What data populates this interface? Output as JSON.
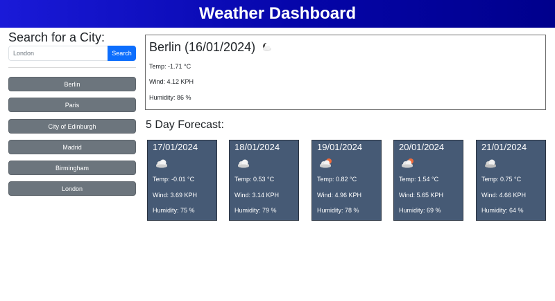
{
  "header": {
    "title": "Weather Dashboard"
  },
  "search": {
    "title": "Search for a City:",
    "input_value": "London",
    "button_label": "Search"
  },
  "history": [
    "Berlin",
    "Paris",
    "City of Edinburgh",
    "Madrid",
    "Birmingham",
    "London"
  ],
  "current": {
    "city_date": "Berlin (16/01/2024)",
    "icon": "moon-cloud-icon",
    "temp": "Temp: -1.71 °C",
    "wind": "Wind: 4.12 KPH",
    "humidity": "Humidity: 86 %"
  },
  "forecast": {
    "title": "5 Day Forecast:",
    "days": [
      {
        "date": "17/01/2024",
        "icon": "cloud-icon",
        "temp": "Temp: -0.01 °C",
        "wind": "Wind: 3.69 KPH",
        "humidity": "Humidity: 75 %"
      },
      {
        "date": "18/01/2024",
        "icon": "cloud-icon",
        "temp": "Temp: 0.53 °C",
        "wind": "Wind: 3.14 KPH",
        "humidity": "Humidity: 79 %"
      },
      {
        "date": "19/01/2024",
        "icon": "sun-cloud-icon",
        "temp": "Temp: 0.82 °C",
        "wind": "Wind: 4.96 KPH",
        "humidity": "Humidity: 78 %"
      },
      {
        "date": "20/01/2024",
        "icon": "sun-cloud-icon",
        "temp": "Temp: 1.54 °C",
        "wind": "Wind: 5.65 KPH",
        "humidity": "Humidity: 69 %"
      },
      {
        "date": "21/01/2024",
        "icon": "cloud-icon",
        "temp": "Temp: 0.75 °C",
        "wind": "Wind: 4.66 KPH",
        "humidity": "Humidity: 64 %"
      }
    ]
  },
  "colors": {
    "header_start": "#1a1ad8",
    "header_end": "#00008c",
    "search_button": "#0d6efd",
    "history_button": "#6c757d",
    "forecast_card": "#465a75"
  }
}
